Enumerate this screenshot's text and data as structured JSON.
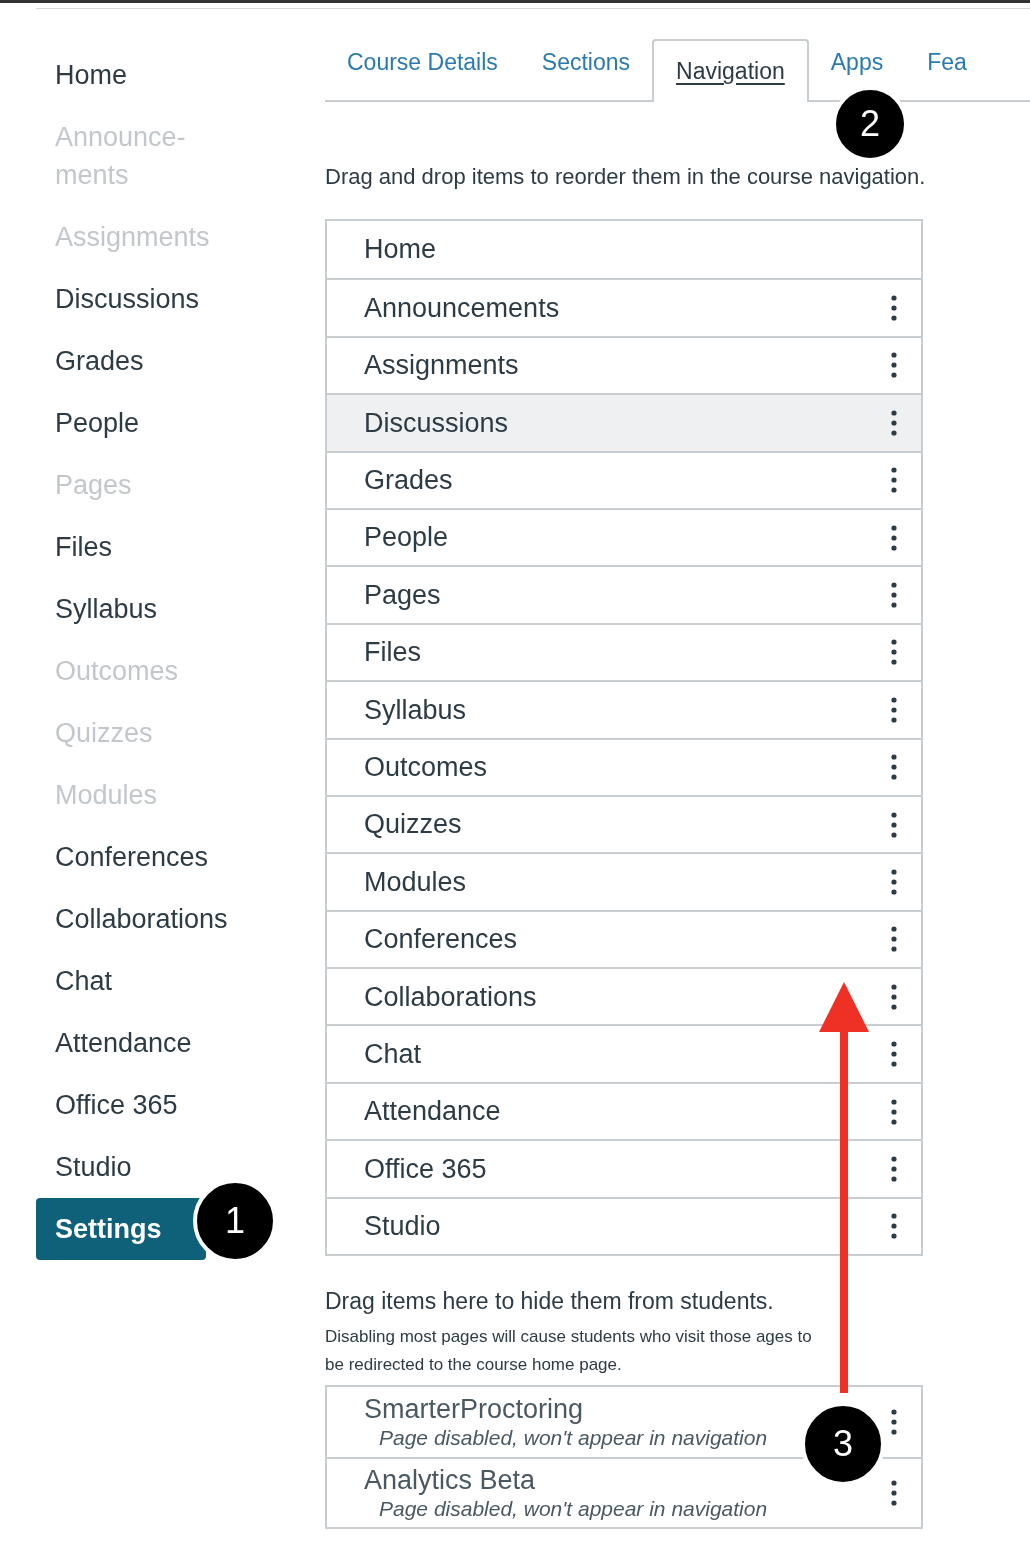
{
  "sidebar": {
    "items": [
      {
        "label": "Home",
        "disabled": false,
        "selected": false
      },
      {
        "label": "Announce-\nments",
        "disabled": true,
        "selected": false
      },
      {
        "label": "Assignments",
        "disabled": true,
        "selected": false
      },
      {
        "label": "Discussions",
        "disabled": false,
        "selected": false
      },
      {
        "label": "Grades",
        "disabled": false,
        "selected": false
      },
      {
        "label": "People",
        "disabled": false,
        "selected": false
      },
      {
        "label": "Pages",
        "disabled": true,
        "selected": false
      },
      {
        "label": "Files",
        "disabled": false,
        "selected": false
      },
      {
        "label": "Syllabus",
        "disabled": false,
        "selected": false
      },
      {
        "label": "Outcomes",
        "disabled": true,
        "selected": false
      },
      {
        "label": "Quizzes",
        "disabled": true,
        "selected": false
      },
      {
        "label": "Modules",
        "disabled": true,
        "selected": false
      },
      {
        "label": "Conferences",
        "disabled": false,
        "selected": false
      },
      {
        "label": "Collaborations",
        "disabled": false,
        "selected": false
      },
      {
        "label": "Chat",
        "disabled": false,
        "selected": false
      },
      {
        "label": "Attendance",
        "disabled": false,
        "selected": false
      },
      {
        "label": "Office 365",
        "disabled": false,
        "selected": false
      },
      {
        "label": "Studio",
        "disabled": false,
        "selected": false
      },
      {
        "label": "Settings",
        "disabled": false,
        "selected": true
      }
    ]
  },
  "tabs": [
    {
      "label": "Course Details",
      "selected": false
    },
    {
      "label": "Sections",
      "selected": false
    },
    {
      "label": "Navigation",
      "selected": true
    },
    {
      "label": "Apps",
      "selected": false
    },
    {
      "label": "Fea",
      "selected": false
    }
  ],
  "instructions": "Drag and drop items to reorder them in the course navigation.",
  "enabled_items": [
    {
      "label": "Home",
      "menu": false,
      "hovered": false
    },
    {
      "label": "Announcements",
      "menu": true,
      "hovered": false
    },
    {
      "label": "Assignments",
      "menu": true,
      "hovered": false
    },
    {
      "label": "Discussions",
      "menu": true,
      "hovered": true
    },
    {
      "label": "Grades",
      "menu": true,
      "hovered": false
    },
    {
      "label": "People",
      "menu": true,
      "hovered": false
    },
    {
      "label": "Pages",
      "menu": true,
      "hovered": false
    },
    {
      "label": "Files",
      "menu": true,
      "hovered": false
    },
    {
      "label": "Syllabus",
      "menu": true,
      "hovered": false
    },
    {
      "label": "Outcomes",
      "menu": true,
      "hovered": false
    },
    {
      "label": "Quizzes",
      "menu": true,
      "hovered": false
    },
    {
      "label": "Modules",
      "menu": true,
      "hovered": false
    },
    {
      "label": "Conferences",
      "menu": true,
      "hovered": false
    },
    {
      "label": "Collaborations",
      "menu": true,
      "hovered": false
    },
    {
      "label": "Chat",
      "menu": true,
      "hovered": false
    },
    {
      "label": "Attendance",
      "menu": true,
      "hovered": false
    },
    {
      "label": "Office 365",
      "menu": true,
      "hovered": false
    },
    {
      "label": "Studio",
      "menu": true,
      "hovered": false
    }
  ],
  "hidden_section": {
    "title": "Drag items here to hide them from students.",
    "note": "Disabling most pages will cause students who visit those ages to\nbe redirected to the course home page.",
    "items": [
      {
        "label": "SmarterProctoring",
        "status": "Page disabled, won't appear in navigation"
      },
      {
        "label": "Analytics Beta",
        "status": "Page disabled, won't appear in navigation"
      }
    ]
  },
  "callouts": [
    "1",
    "2",
    "3"
  ]
}
